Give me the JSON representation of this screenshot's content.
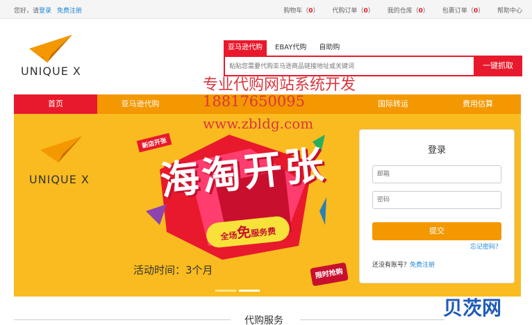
{
  "topbar": {
    "greeting": "您好，请",
    "login": "登录",
    "register": "免费注册",
    "links": [
      {
        "label": "购物车",
        "count": "0"
      },
      {
        "label": "代购订单",
        "count": "0"
      },
      {
        "label": "我的仓库",
        "count": "0"
      },
      {
        "label": "包裹订单",
        "count": "0"
      }
    ],
    "help": "帮助中心"
  },
  "logo": {
    "text": "UNIQUE X"
  },
  "search": {
    "tabs": [
      "亚马逊代购",
      "EBAY代购",
      "自助购"
    ],
    "placeholder": "粘贴您需要代购亚马逊商品链接地址或关键词",
    "button": "一键抓取"
  },
  "nav": [
    "首页",
    "亚马逊代购",
    "",
    "",
    "国际转运",
    "费用估算"
  ],
  "watermark": {
    "line1": "专业代购网站系统开发",
    "line2": "18817650095",
    "line3": "www.zbldg.com"
  },
  "banner": {
    "logo_text": "UNIQUE X",
    "new_shop": "新店开张",
    "slogan": "海淘开张",
    "promo_prefix": "全场",
    "promo_big": "免",
    "promo_suffix": "服务费",
    "period": "活动时间：3个月",
    "limited": "限时抢购"
  },
  "login": {
    "title": "登录",
    "email_placeholder": "邮箱",
    "password_placeholder": "密码",
    "submit": "提交",
    "forgot": "忘记密码？",
    "no_account": "还没有账号？",
    "register": "免费注册"
  },
  "section": {
    "title": "代购服务"
  },
  "site_logo": "贝茨网",
  "colors": {
    "accent": "#e8192c",
    "orange": "#f39800",
    "banner": "#f9bb1f",
    "link": "#1e88d8"
  }
}
